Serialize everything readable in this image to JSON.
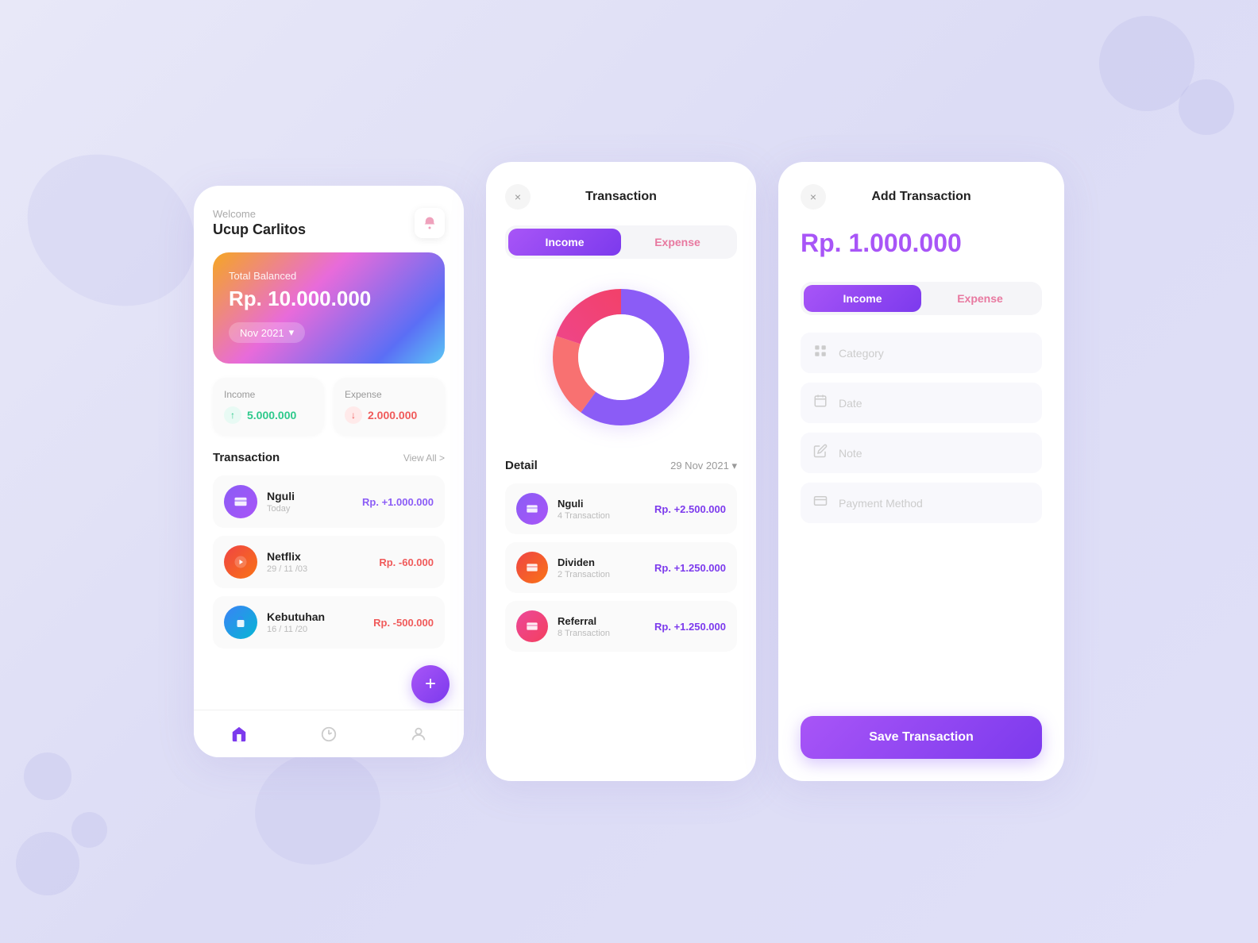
{
  "background": {
    "color": "#e8e8f8"
  },
  "screen1": {
    "welcome": "Welcome",
    "username": "Ucup Carlitos",
    "balance": {
      "label": "Total Balanced",
      "amount": "Rp. 10.000.000",
      "month": "Nov 2021"
    },
    "income": {
      "label": "Income",
      "value": "5.000.000"
    },
    "expense": {
      "label": "Expense",
      "value": "2.000.000"
    },
    "transaction_title": "Transaction",
    "view_all": "View All >",
    "transactions": [
      {
        "name": "Nguli",
        "date": "Today",
        "amount": "Rp. +1.000.000",
        "positive": true
      },
      {
        "name": "Netflix",
        "date": "29 / 11 /03",
        "amount": "Rp. -60.000",
        "positive": false
      },
      {
        "name": "Kebutuhan",
        "date": "16 / 11 /20",
        "amount": "Rp. -500.000",
        "positive": false
      }
    ],
    "nav": [
      "home",
      "chart",
      "user"
    ]
  },
  "screen2": {
    "title": "Transaction",
    "close": "×",
    "tabs": [
      "Income",
      "Expense"
    ],
    "detail_title": "Detail",
    "detail_date": "29 Nov 2021",
    "items": [
      {
        "name": "Nguli",
        "count": "4 Transaction",
        "amount": "Rp. +2.500.000"
      },
      {
        "name": "Dividen",
        "count": "2 Transaction",
        "amount": "Rp. +1.250.000"
      },
      {
        "name": "Referral",
        "count": "8 Transaction",
        "amount": "Rp. +1.250.000"
      }
    ]
  },
  "screen3": {
    "title": "Add Transaction",
    "close": "×",
    "amount": "Rp. 1.000.000",
    "tabs": [
      "Income",
      "Expense"
    ],
    "fields": [
      {
        "label": "Category",
        "icon": "grid"
      },
      {
        "label": "Date",
        "icon": "calendar"
      },
      {
        "label": "Note",
        "icon": "pencil"
      },
      {
        "label": "Payment Method",
        "icon": "card"
      }
    ],
    "save_button": "Save Transaction"
  }
}
